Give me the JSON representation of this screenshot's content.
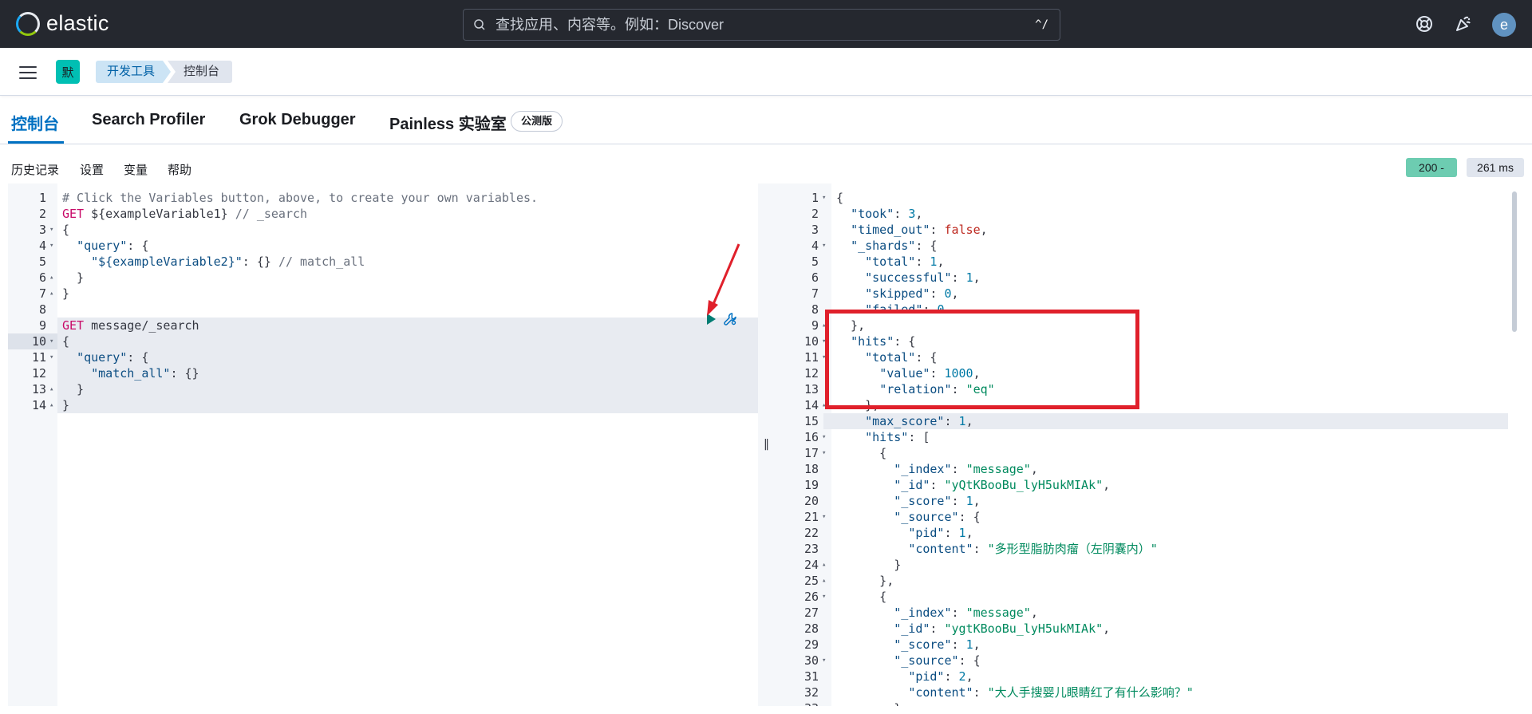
{
  "header": {
    "brand": "elastic",
    "search_placeholder": "查找应用、内容等。例如：Discover",
    "search_shortcut": "^/",
    "avatar_letter": "e"
  },
  "breadcrumbs": {
    "space_letter": "默",
    "items": [
      "开发工具",
      "控制台"
    ]
  },
  "tabs": {
    "items": [
      "控制台",
      "Search Profiler",
      "Grok Debugger",
      "Painless 实验室"
    ],
    "beta_badge": "公测版",
    "active": "控制台"
  },
  "toolbar": {
    "items": [
      "历史记录",
      "设置",
      "变量",
      "帮助"
    ],
    "status": "200 -",
    "time": "261 ms"
  },
  "request_lines": [
    "# Click the Variables button, above, to create your own variables.",
    "GET ${exampleVariable1} // _search",
    "{",
    "  \"query\": {",
    "    \"${exampleVariable2}\": {} // match_all",
    "  }",
    "}",
    "",
    "GET message/_search",
    "{",
    "  \"query\": {",
    "    \"match_all\": {}",
    "  }",
    "}"
  ],
  "response_lines": [
    "{",
    "  \"took\": 3,",
    "  \"timed_out\": false,",
    "  \"_shards\": {",
    "    \"total\": 1,",
    "    \"successful\": 1,",
    "    \"skipped\": 0,",
    "    \"failed\": 0",
    "  },",
    "  \"hits\": {",
    "    \"total\": {",
    "      \"value\": 1000,",
    "      \"relation\": \"eq\"",
    "    },",
    "    \"max_score\": 1,",
    "    \"hits\": [",
    "      {",
    "        \"_index\": \"message\",",
    "        \"_id\": \"yQtKBooBu_lyH5ukMIAk\",",
    "        \"_score\": 1,",
    "        \"_source\": {",
    "          \"pid\": 1,",
    "          \"content\": \"多形型脂肪肉瘤（左阴囊内）\"",
    "        }",
    "      },",
    "      {",
    "        \"_index\": \"message\",",
    "        \"_id\": \"ygtKBooBu_lyH5ukMIAk\",",
    "        \"_score\": 1,",
    "        \"_source\": {",
    "          \"pid\": 2,",
    "          \"content\": \"大人手搜婴儿眼睛红了有什么影响？\"",
    "        }",
    "      }"
  ],
  "colors": {
    "header_bg": "#25282f",
    "accent": "#0071c2",
    "status_ok": "#6dccb1",
    "annotation": "#e0202b",
    "run_green": "#017d73"
  }
}
